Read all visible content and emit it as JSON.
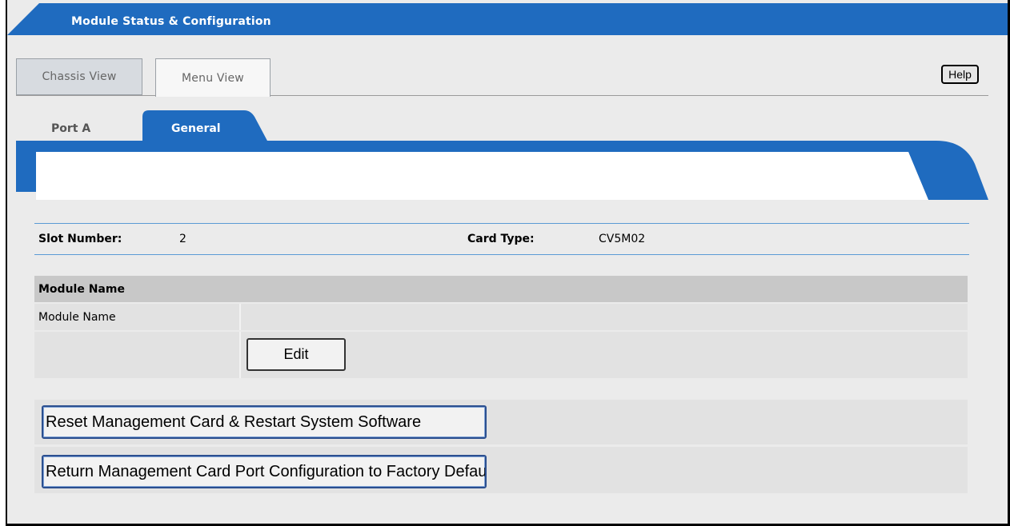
{
  "header": {
    "title": "Module Status & Configuration"
  },
  "view_tabs": [
    {
      "label": "Chassis View",
      "active": false
    },
    {
      "label": "Menu View",
      "active": true
    }
  ],
  "help_label": "Help",
  "port_tabs": [
    {
      "label": "Port A",
      "active": false
    },
    {
      "label": "General",
      "active": true
    }
  ],
  "info": {
    "slot_label": "Slot Number:",
    "slot_value": "2",
    "card_type_label": "Card Type:",
    "card_type_value": "CV5M02"
  },
  "module_name_section": {
    "heading": "Module Name",
    "row_label": "Module Name",
    "row_value": "",
    "edit_label": "Edit"
  },
  "actions": {
    "reset_label": "Reset Management Card & Restart System Software",
    "return_label": "Return Management Card Port Configuration to Factory Defaults"
  },
  "colors": {
    "banner_blue": "#1f6bbf",
    "tab_blue": "#1f6bbf",
    "panel_bg": "#ebebeb",
    "row_bg": "#e2e2e2",
    "section_head_bg": "#c8c8c8",
    "rule_blue": "#5b9bd5"
  }
}
